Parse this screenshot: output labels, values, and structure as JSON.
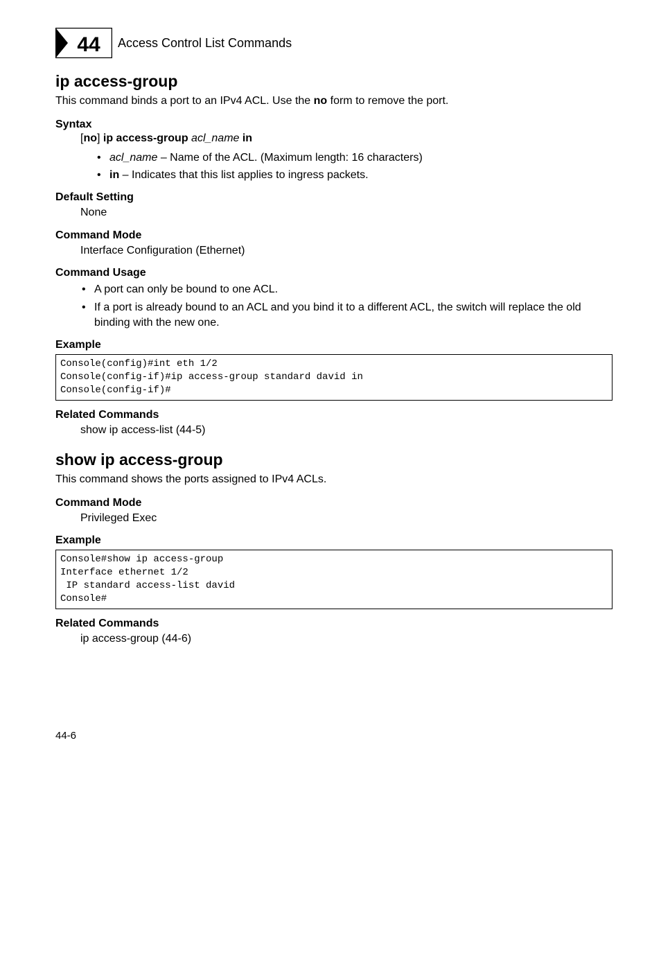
{
  "header": {
    "chapter_number": "44",
    "chapter_title": "Access Control List Commands"
  },
  "cmd1": {
    "title": "ip access-group",
    "lead_pre": "This command binds a port to an IPv4 ACL. Use the ",
    "lead_bold": "no",
    "lead_post": " form to remove the port.",
    "syntax_heading": "Syntax",
    "syntax_line": {
      "open": "[",
      "no": "no",
      "close_cmd": "] ",
      "cmd": "ip access-group",
      "arg": " acl_name ",
      "opt": "in"
    },
    "params": [
      {
        "name": "acl_name",
        "sep": " – ",
        "desc": "Name of the ACL. (Maximum length: 16 characters)"
      },
      {
        "name": "in",
        "sep": " – ",
        "desc": "Indicates that this list applies to ingress packets."
      }
    ],
    "default_heading": "Default Setting",
    "default_value": "None",
    "mode_heading": "Command Mode",
    "mode_value": "Interface Configuration (Ethernet)",
    "usage_heading": "Command Usage",
    "usage": [
      "A port can only be bound to one ACL.",
      "If a port is already bound to an ACL and you bind it to a different ACL, the switch will replace the old binding with the new one."
    ],
    "example_heading": "Example",
    "example_code": "Console(config)#int eth 1/2\nConsole(config-if)#ip access-group standard david in\nConsole(config-if)#",
    "related_heading": "Related Commands",
    "related_value": "show ip access-list (44-5)"
  },
  "cmd2": {
    "title": "show ip access-group",
    "lead": "This command shows the ports assigned to IPv4 ACLs.",
    "mode_heading": "Command Mode",
    "mode_value": "Privileged Exec",
    "example_heading": "Example",
    "example_code": "Console#show ip access-group\nInterface ethernet 1/2\n IP standard access-list david\nConsole#",
    "related_heading": "Related Commands",
    "related_value": "ip access-group (44-6)"
  },
  "page_number": "44-6"
}
